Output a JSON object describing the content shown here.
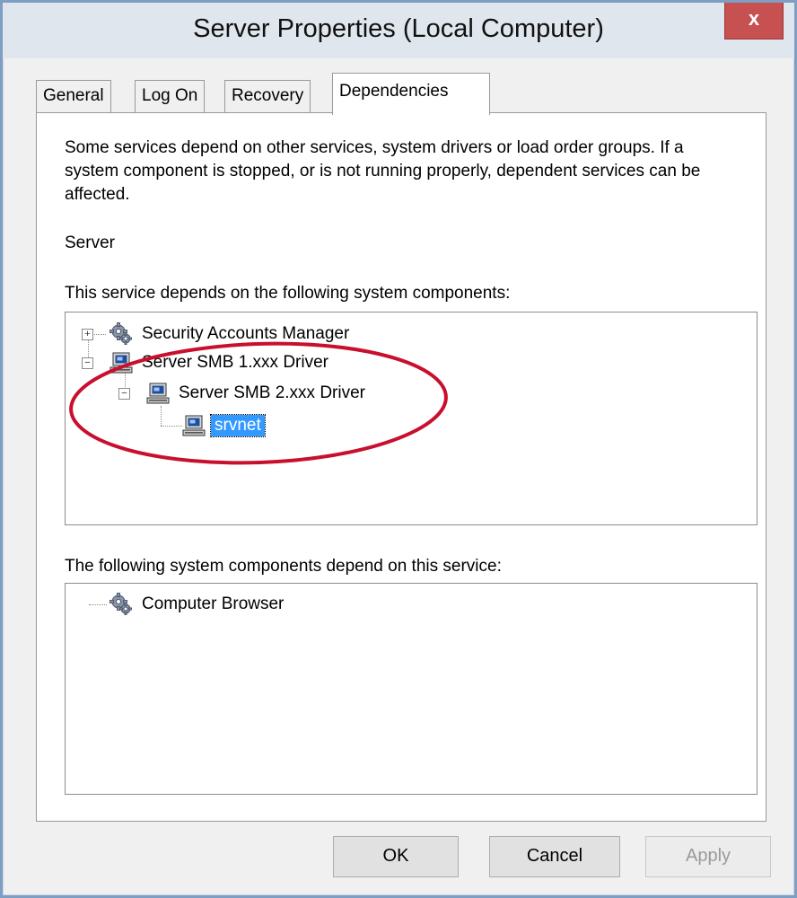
{
  "window": {
    "title": "Server Properties (Local Computer)",
    "close_label": "x"
  },
  "tabs": [
    {
      "label": "General"
    },
    {
      "label": "Log On"
    },
    {
      "label": "Recovery"
    },
    {
      "label": "Dependencies",
      "active": true
    }
  ],
  "panel": {
    "description": "Some services depend on other services, system drivers or load order groups. If a system component is stopped, or is not running properly, dependent services can be affected.",
    "service_name": "Server",
    "depends_on_label": "This service depends on the following system components:",
    "depends_on_tree": [
      {
        "label": "Security Accounts Manager",
        "icon": "gear-icon",
        "expander": "+"
      },
      {
        "label": "Server SMB 1.xxx Driver",
        "icon": "computer-icon",
        "expander": "−"
      },
      {
        "label": "Server SMB 2.xxx Driver",
        "icon": "computer-icon",
        "expander": "−"
      },
      {
        "label": "srvnet",
        "icon": "computer-icon",
        "selected": true
      }
    ],
    "dependents_label": "The following system components depend on this service:",
    "dependents_tree": [
      {
        "label": "Computer Browser",
        "icon": "gear-icon"
      }
    ]
  },
  "buttons": {
    "ok": "OK",
    "cancel": "Cancel",
    "apply": "Apply"
  },
  "colors": {
    "selection": "#3399ff",
    "annotation": "#c8102e",
    "close_button": "#c75050"
  }
}
